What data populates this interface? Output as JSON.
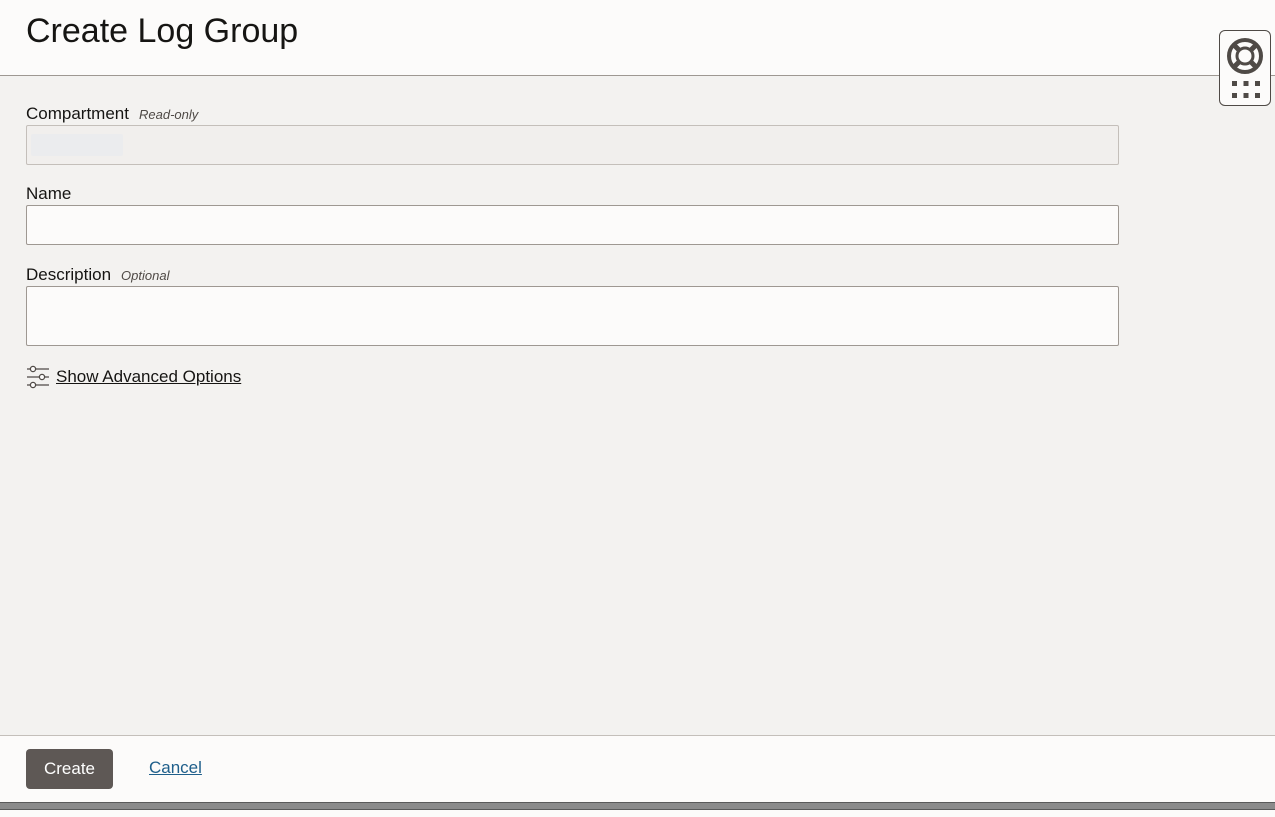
{
  "page": {
    "title": "Create Log Group"
  },
  "help_widget": {
    "icons": [
      "lifebuoy-icon",
      "grid-icon"
    ]
  },
  "form": {
    "compartment": {
      "label": "Compartment",
      "hint": "Read-only",
      "value": ""
    },
    "name": {
      "label": "Name",
      "value": ""
    },
    "description": {
      "label": "Description",
      "hint": "Optional",
      "value": ""
    },
    "advanced": {
      "label": "Show Advanced Options",
      "icon": "sliders-icon"
    }
  },
  "footer": {
    "create_label": "Create",
    "cancel_label": "Cancel"
  },
  "colors": {
    "primary_button": "#5e5855",
    "link": "#1f5f8b",
    "page_bg": "#f3f2f0",
    "panel_bg": "#fcfbfa"
  }
}
